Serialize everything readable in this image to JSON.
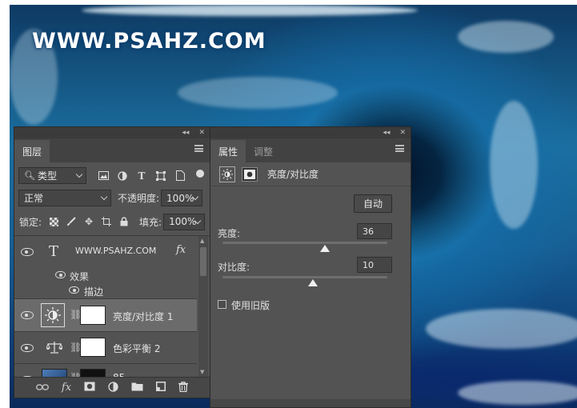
{
  "watermark": "WWW.PSAHZ.COM",
  "layers_panel": {
    "tab": "图层",
    "filter_kind": "类型",
    "blend_mode": "正常",
    "opacity_label": "不透明度:",
    "opacity_value": "100%",
    "lock_label": "锁定:",
    "fill_label": "填充:",
    "fill_value": "100%",
    "layers": [
      {
        "type": "text",
        "glyph": "T",
        "name": "WWW.PSAHZ.COM",
        "fx": "fx"
      },
      {
        "type": "effects",
        "label": "效果"
      },
      {
        "type": "effect",
        "label": "描边"
      },
      {
        "type": "adjustment",
        "name": "亮度/对比度 1",
        "icon": "brightness-contrast-icon"
      },
      {
        "type": "adjustment",
        "name": "色彩平衡 2",
        "icon": "balance-scale-icon"
      },
      {
        "type": "image",
        "name": "85"
      }
    ],
    "bottom_icons": [
      "link-icon",
      "fx-icon",
      "mask-icon",
      "adjustment-icon",
      "folder-icon",
      "new-layer-icon",
      "trash-icon"
    ],
    "bottom_fx": "fx"
  },
  "properties_panel": {
    "tabs": [
      "属性",
      "调整"
    ],
    "active_tab": "属性",
    "title": "亮度/对比度",
    "auto_button": "自动",
    "brightness": {
      "label": "亮度:",
      "value": "36",
      "fraction": 0.62
    },
    "contrast": {
      "label": "对比度:",
      "value": "10",
      "fraction": 0.55
    },
    "legacy_label": "使用旧版",
    "legacy_checked": false
  },
  "colors": {
    "panel_bg": "#535353",
    "tab_bar": "#424242",
    "selected_layer": "#6b6b6b"
  }
}
